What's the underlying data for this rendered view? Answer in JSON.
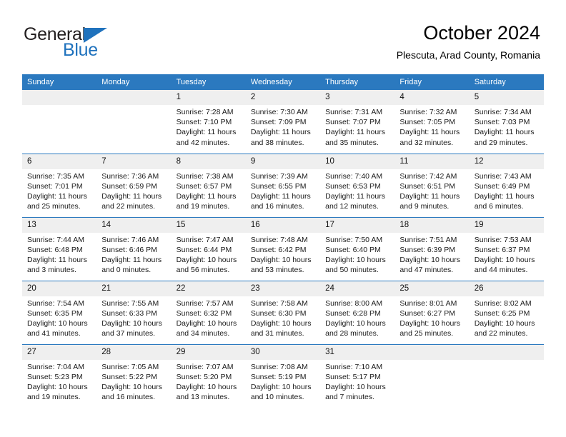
{
  "brand": {
    "name_part1": "General",
    "name_part2": "Blue",
    "accent_color": "#1f72bd"
  },
  "header": {
    "title": "October 2024",
    "subtitle": "Plescuta, Arad County, Romania"
  },
  "theme": {
    "header_bar_color": "#2b79bf",
    "daynum_band_color": "#efefef"
  },
  "weekday_headers": [
    "Sunday",
    "Monday",
    "Tuesday",
    "Wednesday",
    "Thursday",
    "Friday",
    "Saturday"
  ],
  "weeks": [
    [
      {
        "day": "",
        "empty": true
      },
      {
        "day": "",
        "empty": true
      },
      {
        "day": "1",
        "sunrise": "Sunrise: 7:28 AM",
        "sunset": "Sunset: 7:10 PM",
        "daylight1": "Daylight: 11 hours",
        "daylight2": "and 42 minutes."
      },
      {
        "day": "2",
        "sunrise": "Sunrise: 7:30 AM",
        "sunset": "Sunset: 7:09 PM",
        "daylight1": "Daylight: 11 hours",
        "daylight2": "and 38 minutes."
      },
      {
        "day": "3",
        "sunrise": "Sunrise: 7:31 AM",
        "sunset": "Sunset: 7:07 PM",
        "daylight1": "Daylight: 11 hours",
        "daylight2": "and 35 minutes."
      },
      {
        "day": "4",
        "sunrise": "Sunrise: 7:32 AM",
        "sunset": "Sunset: 7:05 PM",
        "daylight1": "Daylight: 11 hours",
        "daylight2": "and 32 minutes."
      },
      {
        "day": "5",
        "sunrise": "Sunrise: 7:34 AM",
        "sunset": "Sunset: 7:03 PM",
        "daylight1": "Daylight: 11 hours",
        "daylight2": "and 29 minutes."
      }
    ],
    [
      {
        "day": "6",
        "sunrise": "Sunrise: 7:35 AM",
        "sunset": "Sunset: 7:01 PM",
        "daylight1": "Daylight: 11 hours",
        "daylight2": "and 25 minutes."
      },
      {
        "day": "7",
        "sunrise": "Sunrise: 7:36 AM",
        "sunset": "Sunset: 6:59 PM",
        "daylight1": "Daylight: 11 hours",
        "daylight2": "and 22 minutes."
      },
      {
        "day": "8",
        "sunrise": "Sunrise: 7:38 AM",
        "sunset": "Sunset: 6:57 PM",
        "daylight1": "Daylight: 11 hours",
        "daylight2": "and 19 minutes."
      },
      {
        "day": "9",
        "sunrise": "Sunrise: 7:39 AM",
        "sunset": "Sunset: 6:55 PM",
        "daylight1": "Daylight: 11 hours",
        "daylight2": "and 16 minutes."
      },
      {
        "day": "10",
        "sunrise": "Sunrise: 7:40 AM",
        "sunset": "Sunset: 6:53 PM",
        "daylight1": "Daylight: 11 hours",
        "daylight2": "and 12 minutes."
      },
      {
        "day": "11",
        "sunrise": "Sunrise: 7:42 AM",
        "sunset": "Sunset: 6:51 PM",
        "daylight1": "Daylight: 11 hours",
        "daylight2": "and 9 minutes."
      },
      {
        "day": "12",
        "sunrise": "Sunrise: 7:43 AM",
        "sunset": "Sunset: 6:49 PM",
        "daylight1": "Daylight: 11 hours",
        "daylight2": "and 6 minutes."
      }
    ],
    [
      {
        "day": "13",
        "sunrise": "Sunrise: 7:44 AM",
        "sunset": "Sunset: 6:48 PM",
        "daylight1": "Daylight: 11 hours",
        "daylight2": "and 3 minutes."
      },
      {
        "day": "14",
        "sunrise": "Sunrise: 7:46 AM",
        "sunset": "Sunset: 6:46 PM",
        "daylight1": "Daylight: 11 hours",
        "daylight2": "and 0 minutes."
      },
      {
        "day": "15",
        "sunrise": "Sunrise: 7:47 AM",
        "sunset": "Sunset: 6:44 PM",
        "daylight1": "Daylight: 10 hours",
        "daylight2": "and 56 minutes."
      },
      {
        "day": "16",
        "sunrise": "Sunrise: 7:48 AM",
        "sunset": "Sunset: 6:42 PM",
        "daylight1": "Daylight: 10 hours",
        "daylight2": "and 53 minutes."
      },
      {
        "day": "17",
        "sunrise": "Sunrise: 7:50 AM",
        "sunset": "Sunset: 6:40 PM",
        "daylight1": "Daylight: 10 hours",
        "daylight2": "and 50 minutes."
      },
      {
        "day": "18",
        "sunrise": "Sunrise: 7:51 AM",
        "sunset": "Sunset: 6:39 PM",
        "daylight1": "Daylight: 10 hours",
        "daylight2": "and 47 minutes."
      },
      {
        "day": "19",
        "sunrise": "Sunrise: 7:53 AM",
        "sunset": "Sunset: 6:37 PM",
        "daylight1": "Daylight: 10 hours",
        "daylight2": "and 44 minutes."
      }
    ],
    [
      {
        "day": "20",
        "sunrise": "Sunrise: 7:54 AM",
        "sunset": "Sunset: 6:35 PM",
        "daylight1": "Daylight: 10 hours",
        "daylight2": "and 41 minutes."
      },
      {
        "day": "21",
        "sunrise": "Sunrise: 7:55 AM",
        "sunset": "Sunset: 6:33 PM",
        "daylight1": "Daylight: 10 hours",
        "daylight2": "and 37 minutes."
      },
      {
        "day": "22",
        "sunrise": "Sunrise: 7:57 AM",
        "sunset": "Sunset: 6:32 PM",
        "daylight1": "Daylight: 10 hours",
        "daylight2": "and 34 minutes."
      },
      {
        "day": "23",
        "sunrise": "Sunrise: 7:58 AM",
        "sunset": "Sunset: 6:30 PM",
        "daylight1": "Daylight: 10 hours",
        "daylight2": "and 31 minutes."
      },
      {
        "day": "24",
        "sunrise": "Sunrise: 8:00 AM",
        "sunset": "Sunset: 6:28 PM",
        "daylight1": "Daylight: 10 hours",
        "daylight2": "and 28 minutes."
      },
      {
        "day": "25",
        "sunrise": "Sunrise: 8:01 AM",
        "sunset": "Sunset: 6:27 PM",
        "daylight1": "Daylight: 10 hours",
        "daylight2": "and 25 minutes."
      },
      {
        "day": "26",
        "sunrise": "Sunrise: 8:02 AM",
        "sunset": "Sunset: 6:25 PM",
        "daylight1": "Daylight: 10 hours",
        "daylight2": "and 22 minutes."
      }
    ],
    [
      {
        "day": "27",
        "sunrise": "Sunrise: 7:04 AM",
        "sunset": "Sunset: 5:23 PM",
        "daylight1": "Daylight: 10 hours",
        "daylight2": "and 19 minutes."
      },
      {
        "day": "28",
        "sunrise": "Sunrise: 7:05 AM",
        "sunset": "Sunset: 5:22 PM",
        "daylight1": "Daylight: 10 hours",
        "daylight2": "and 16 minutes."
      },
      {
        "day": "29",
        "sunrise": "Sunrise: 7:07 AM",
        "sunset": "Sunset: 5:20 PM",
        "daylight1": "Daylight: 10 hours",
        "daylight2": "and 13 minutes."
      },
      {
        "day": "30",
        "sunrise": "Sunrise: 7:08 AM",
        "sunset": "Sunset: 5:19 PM",
        "daylight1": "Daylight: 10 hours",
        "daylight2": "and 10 minutes."
      },
      {
        "day": "31",
        "sunrise": "Sunrise: 7:10 AM",
        "sunset": "Sunset: 5:17 PM",
        "daylight1": "Daylight: 10 hours",
        "daylight2": "and 7 minutes."
      },
      {
        "day": "",
        "empty": true
      },
      {
        "day": "",
        "empty": true
      }
    ]
  ]
}
